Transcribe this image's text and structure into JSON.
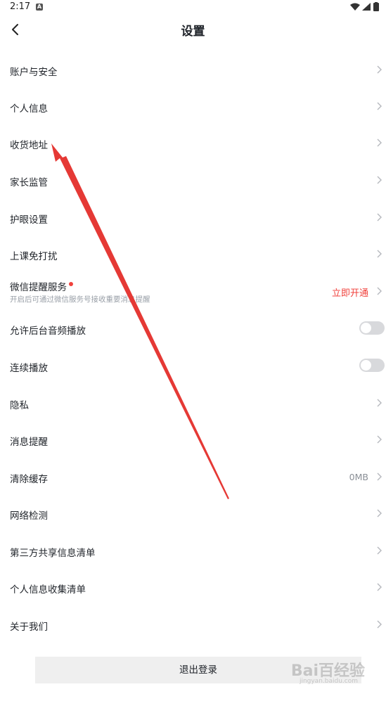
{
  "status": {
    "time": "2:17",
    "notif_icon": "A"
  },
  "header": {
    "title": "设置",
    "back_icon": "chevron-left-icon"
  },
  "items": [
    {
      "label": "账户与安全"
    },
    {
      "label": "个人信息"
    },
    {
      "label": "收货地址"
    },
    {
      "label": "家长监管"
    },
    {
      "label": "护眼设置"
    },
    {
      "label": "上课免打扰"
    },
    {
      "label": "微信提醒服务",
      "sub": "开启后可通过微信服务号接收重要消息提醒",
      "value": "立即开通"
    },
    {
      "label": "允许后台音频播放",
      "toggle": false
    },
    {
      "label": "连续播放",
      "toggle": false
    },
    {
      "label": "隐私"
    },
    {
      "label": "消息提醒"
    },
    {
      "label": "清除缓存",
      "value": "0MB"
    },
    {
      "label": "网络检测"
    },
    {
      "label": "第三方共享信息清单"
    },
    {
      "label": "个人信息收集清单"
    },
    {
      "label": "关于我们"
    }
  ],
  "logout": {
    "label": "退出登录"
  },
  "watermark": {
    "text": "Bai百经验",
    "sub": "jingyan.baidu.com"
  },
  "colors": {
    "accent_red": "#f0413c",
    "annotation_arrow": "#e53935"
  }
}
